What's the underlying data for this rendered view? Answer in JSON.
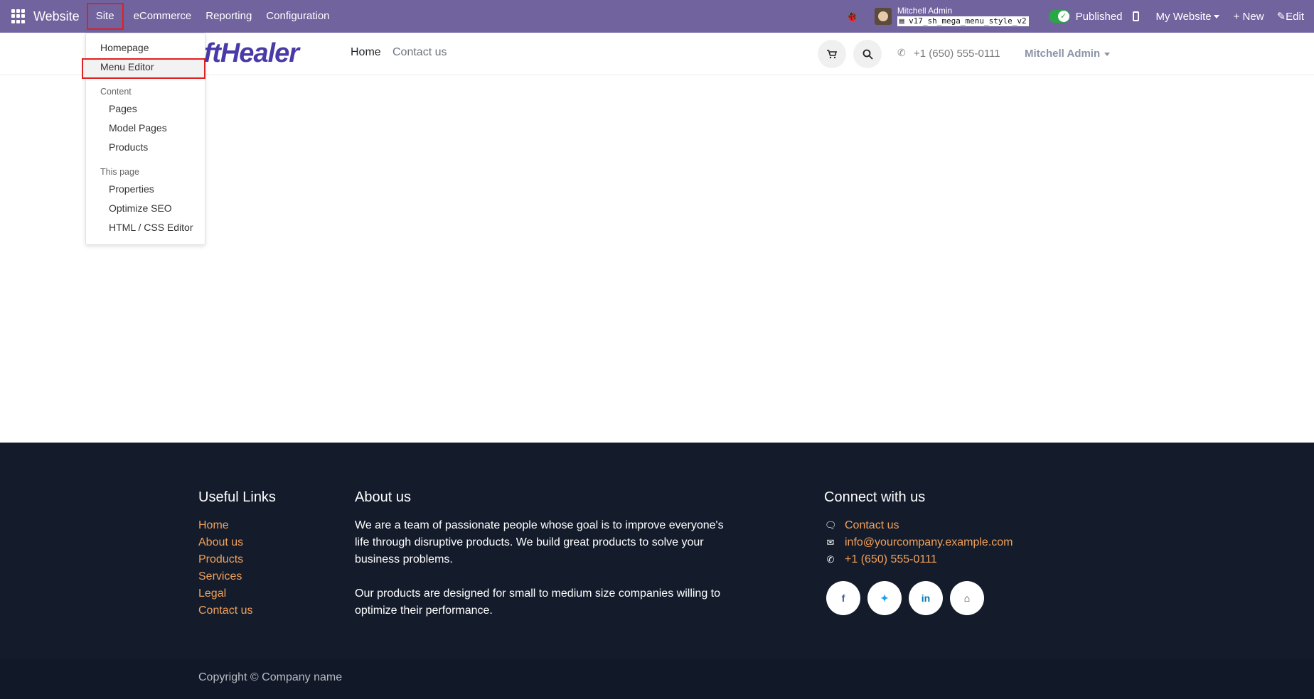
{
  "topbar": {
    "brand": "Website",
    "menus": [
      "Site",
      "eCommerce",
      "Reporting",
      "Configuration"
    ],
    "user_name": "Mitchell Admin",
    "db_name": "v17_sh_mega_menu_style_v2",
    "published_label": "Published",
    "my_website_label": "My Website",
    "new_label": "New",
    "edit_label": "Edit"
  },
  "header": {
    "logo_text": "SoftHealer",
    "nav": [
      "Home",
      "Contact us"
    ],
    "phone": "+1 (650) 555-0111",
    "account": "Mitchell Admin"
  },
  "site_menu": {
    "homepage": "Homepage",
    "menu_editor": "Menu Editor",
    "content_header": "Content",
    "content_items": [
      "Pages",
      "Model Pages",
      "Products"
    ],
    "page_header": "This page",
    "page_items": [
      "Properties",
      "Optimize SEO",
      "HTML / CSS Editor"
    ]
  },
  "footer": {
    "useful_links_title": "Useful Links",
    "useful_links": [
      "Home",
      "About us",
      "Products",
      "Services",
      "Legal",
      "Contact us"
    ],
    "about_title": "About us",
    "about_p1": "We are a team of passionate people whose goal is to improve everyone's life through disruptive products. We build great products to solve your business problems.",
    "about_p2": "Our products are designed for small to medium size companies willing to optimize their performance.",
    "connect_title": "Connect with us",
    "contact_us": "Contact us",
    "email": "info@yourcompany.example.com",
    "phone": "+1 (650) 555-0111",
    "copyright": "Copyright © Company name"
  },
  "colors": {
    "topbar": "#71639e",
    "footer_bg": "#141c2b",
    "link_accent": "#f0a05a",
    "highlight": "#e02020"
  }
}
